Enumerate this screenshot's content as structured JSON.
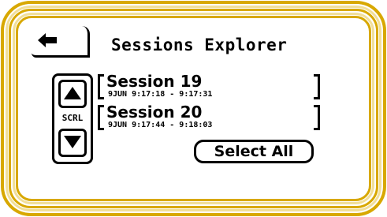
{
  "header": {
    "title": "Sessions Explorer",
    "back_icon": "left-arrow-icon"
  },
  "scroll": {
    "label": "SCRL",
    "up_icon": "triangle-up-icon",
    "down_icon": "triangle-down-icon"
  },
  "sessions": [
    {
      "name": "Session 19",
      "time": "9JUN 9:17:18 - 9:17:31"
    },
    {
      "name": "Session 20",
      "time": "9JUN 9:17:44 - 9:18:03"
    }
  ],
  "actions": {
    "select_all_label": "Select All"
  },
  "colors": {
    "bezel_gold": "#d8a800",
    "bezel_light": "#f1df9a",
    "foreground": "#000000",
    "background": "#ffffff"
  }
}
